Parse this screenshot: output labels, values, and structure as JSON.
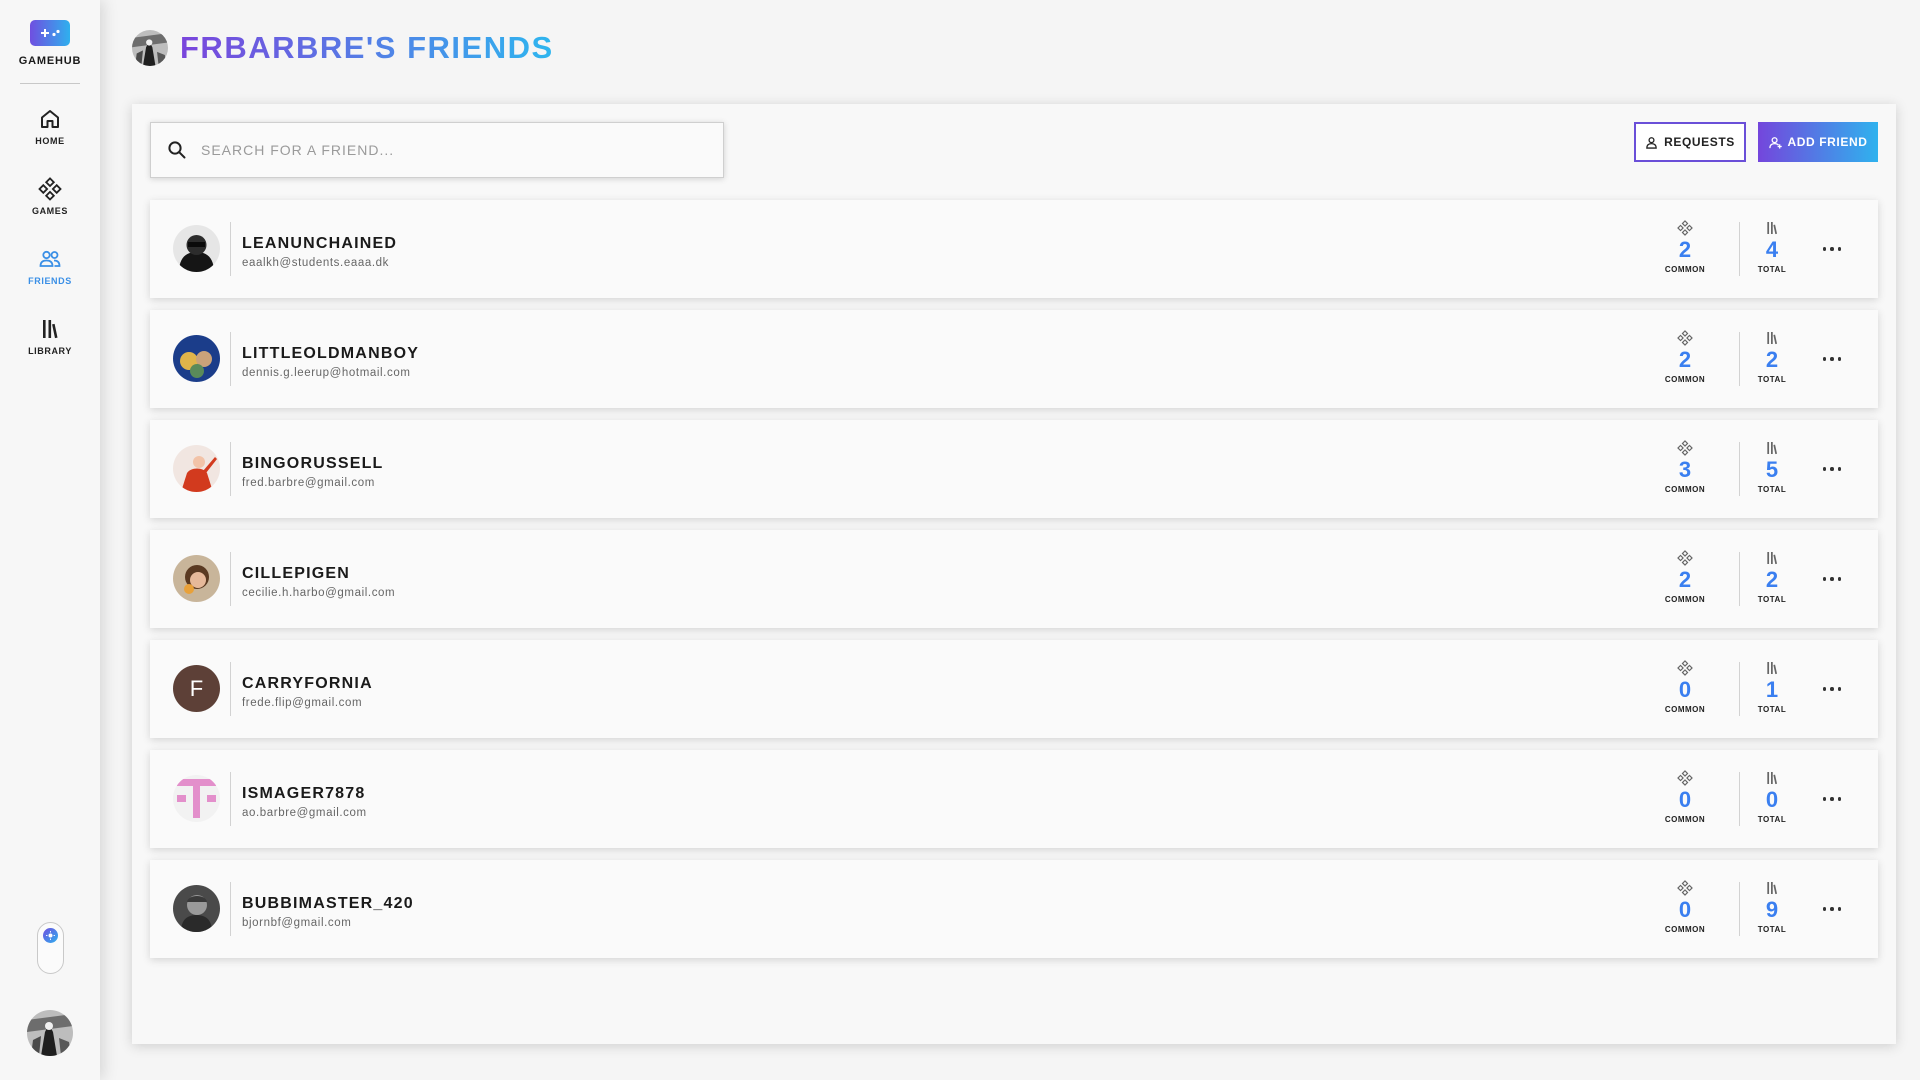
{
  "app": {
    "name": "GAMEHUB"
  },
  "nav": [
    {
      "label": "HOME",
      "icon": "home-icon"
    },
    {
      "label": "GAMES",
      "icon": "gamepad-icon"
    },
    {
      "label": "FRIENDS",
      "icon": "friends-icon",
      "active": true
    },
    {
      "label": "LIBRARY",
      "icon": "library-icon"
    }
  ],
  "header": {
    "title": "FRBARBRE'S FRIENDS"
  },
  "search": {
    "placeholder": "SEARCH FOR A FRIEND...",
    "value": ""
  },
  "toolbar": {
    "requests_label": "REQUESTS",
    "add_friend_label": "ADD FRIEND"
  },
  "stats_labels": {
    "common": "COMMON",
    "total": "TOTAL"
  },
  "colors": {
    "accent_purple": "#7446dc",
    "accent_blue": "#2fb2ee",
    "stat_blue": "#3a7ff0"
  },
  "friends": [
    {
      "name": "LEANUNCHAINED",
      "email": "eaalkh@students.eaaa.dk",
      "common": "2",
      "total": "4"
    },
    {
      "name": "LITTLEOLDMANBOY",
      "email": "dennis.g.leerup@hotmail.com",
      "common": "2",
      "total": "2"
    },
    {
      "name": "BINGORUSSELL",
      "email": "fred.barbre@gmail.com",
      "common": "3",
      "total": "5"
    },
    {
      "name": "CILLEPIGEN",
      "email": "cecilie.h.harbo@gmail.com",
      "common": "2",
      "total": "2"
    },
    {
      "name": "CARRYFORNIA",
      "email": "frede.flip@gmail.com",
      "common": "0",
      "total": "1",
      "avatar_letter": "F"
    },
    {
      "name": "ISMAGER7878",
      "email": "ao.barbre@gmail.com",
      "common": "0",
      "total": "0"
    },
    {
      "name": "BUBBIMASTER_420",
      "email": "bjornbf@gmail.com",
      "common": "0",
      "total": "9"
    }
  ]
}
